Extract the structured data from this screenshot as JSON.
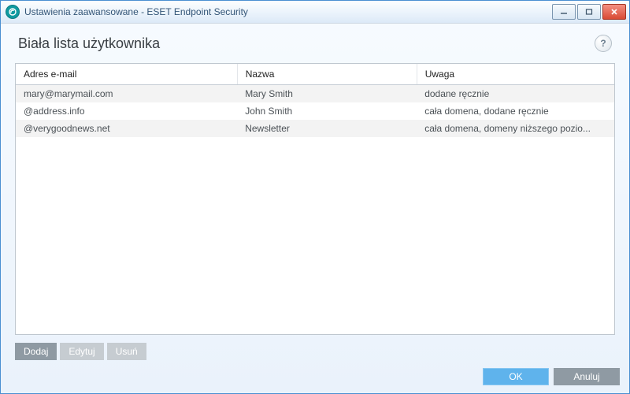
{
  "window": {
    "title": "Ustawienia zaawansowane - ESET Endpoint Security"
  },
  "header": {
    "title": "Biała lista użytkownika",
    "help_tooltip": "?"
  },
  "table": {
    "columns": {
      "email": "Adres e-mail",
      "name": "Nazwa",
      "note": "Uwaga"
    },
    "rows": [
      {
        "email": "mary@marymail.com",
        "name": "Mary Smith",
        "note": "dodane ręcznie"
      },
      {
        "email": "@address.info",
        "name": "John Smith",
        "note": "cała domena, dodane ręcznie"
      },
      {
        "email": "@verygoodnews.net",
        "name": "Newsletter",
        "note": "cała domena, domeny niższego pozio..."
      }
    ]
  },
  "actions": {
    "add": "Dodaj",
    "edit": "Edytuj",
    "delete": "Usuń"
  },
  "footer": {
    "ok": "OK",
    "cancel": "Anuluj"
  }
}
